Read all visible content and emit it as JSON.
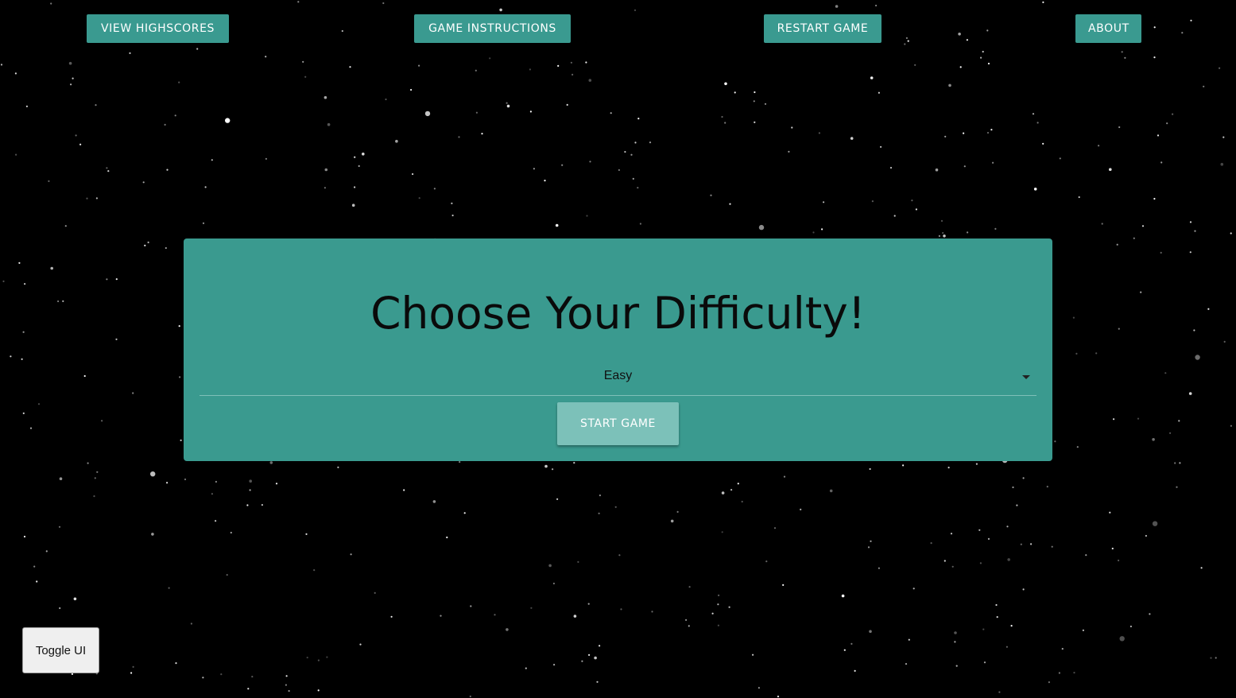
{
  "nav": {
    "highscores_label": "VIEW HIGHSCORES",
    "instructions_label": "GAME INSTRUCTIONS",
    "restart_label": "RESTART GAME",
    "about_label": "ABOUT"
  },
  "panel": {
    "title": "Choose Your Difficulty!",
    "difficulty_selected": "Easy",
    "start_label": "START GAME"
  },
  "toggle_ui_label": "Toggle UI",
  "colors": {
    "accent": "#3a9a90",
    "start_button": "#7cc1b9",
    "background": "#000000"
  },
  "icons": {
    "select_caret": "caret-down-icon"
  }
}
